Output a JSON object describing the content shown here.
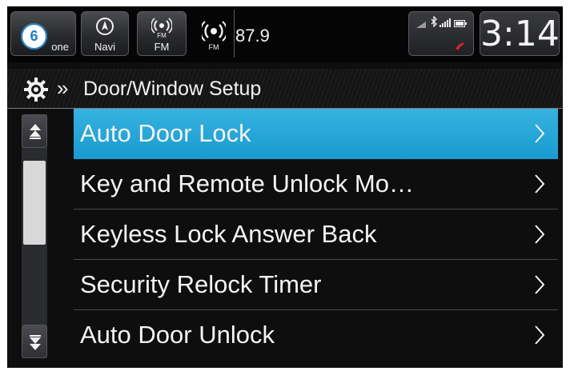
{
  "topbar": {
    "phone_label": "one",
    "navi_label": "Navi",
    "fm_label": "FM",
    "fm_icon_text": "FM",
    "radio_icon_text": "FM",
    "frequency": "87.9",
    "clock": "3:14",
    "step_badge": "6"
  },
  "header": {
    "crumb": "»",
    "title": "Door/Window Setup"
  },
  "menu": {
    "items": [
      {
        "label": "Auto Door Lock"
      },
      {
        "label": "Key and Remote Unlock Mo…"
      },
      {
        "label": "Keyless Lock Answer Back"
      },
      {
        "label": "Security Relock Timer"
      },
      {
        "label": "Auto Door Unlock"
      }
    ]
  },
  "colors": {
    "selected_row": "#2aa8db",
    "badge_ring": "#1d7fc6"
  },
  "icons": {
    "settings": "gear-icon",
    "scroll_up": "double-up-arrow-icon",
    "scroll_down": "double-down-arrow-icon",
    "row_chevron": "chevron-right-icon"
  }
}
